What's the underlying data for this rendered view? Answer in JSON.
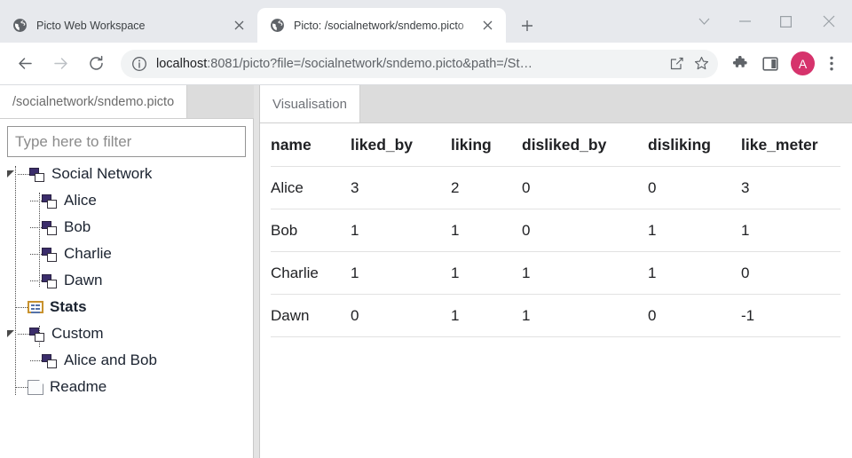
{
  "browser": {
    "tabs": [
      {
        "title": "Picto Web Workspace",
        "favicon": "globe-icon",
        "active": false,
        "close_label": "×"
      },
      {
        "title": "Picto: /socialnetwork/sndemo.picto",
        "favicon": "globe-icon",
        "active": true,
        "close_label": "×"
      }
    ],
    "new_tab_label": "+",
    "window_controls": {
      "tab_search": "tab-search-icon",
      "minimize": "minimize-icon",
      "maximize": "maximize-icon",
      "close": "close-icon"
    },
    "toolbar": {
      "back": "back-arrow-icon",
      "forward": "forward-arrow-icon",
      "reload": "reload-icon",
      "site_info": "info-circle-icon",
      "url_host": "localhost",
      "url_rest": ":8081/picto?file=/socialnetwork/sndemo.picto&path=/St…",
      "url_full": "localhost:8081/picto?file=/socialnetwork/sndemo.picto&path=/St…",
      "share": "share-icon",
      "bookmark": "star-icon",
      "extensions": "puzzle-piece-icon",
      "side_panel": "side-panel-icon",
      "profile_initial": "A",
      "profile_color": "#d6336c",
      "menu": "three-dot-menu-icon"
    }
  },
  "left_panel": {
    "tab_label": "/socialnetwork/sndemo.picto",
    "filter": {
      "value": "",
      "placeholder": "Type here to filter"
    },
    "tree": [
      {
        "label": "Social Network",
        "icon": "node-icon",
        "depth": 0,
        "expanded": true,
        "selected": false
      },
      {
        "label": "Alice",
        "icon": "node-icon",
        "depth": 1,
        "expanded": false,
        "selected": false
      },
      {
        "label": "Bob",
        "icon": "node-icon",
        "depth": 1,
        "expanded": false,
        "selected": false
      },
      {
        "label": "Charlie",
        "icon": "node-icon",
        "depth": 1,
        "expanded": false,
        "selected": false
      },
      {
        "label": "Dawn",
        "icon": "node-icon",
        "depth": 1,
        "expanded": false,
        "selected": false
      },
      {
        "label": "Stats",
        "icon": "table-icon",
        "depth": 0,
        "expanded": false,
        "selected": true
      },
      {
        "label": "Custom",
        "icon": "node-icon",
        "depth": 0,
        "expanded": true,
        "selected": false
      },
      {
        "label": "Alice and Bob",
        "icon": "node-icon",
        "depth": 1,
        "expanded": false,
        "selected": false
      },
      {
        "label": "Readme",
        "icon": "document-icon",
        "depth": 0,
        "expanded": false,
        "selected": false
      }
    ]
  },
  "right_panel": {
    "tab_label": "Visualisation",
    "table": {
      "columns": [
        "name",
        "liked_by",
        "liking",
        "disliked_by",
        "disliking",
        "like_meter"
      ],
      "rows": [
        {
          "name": "Alice",
          "liked_by": "3",
          "liking": "2",
          "disliked_by": "0",
          "disliking": "0",
          "like_meter": "3"
        },
        {
          "name": "Bob",
          "liked_by": "1",
          "liking": "1",
          "disliked_by": "0",
          "disliking": "1",
          "like_meter": "1"
        },
        {
          "name": "Charlie",
          "liked_by": "1",
          "liking": "1",
          "disliked_by": "1",
          "disliking": "1",
          "like_meter": "0"
        },
        {
          "name": "Dawn",
          "liked_by": "0",
          "liking": "1",
          "disliked_by": "1",
          "disliking": "0",
          "like_meter": "-1"
        }
      ]
    }
  }
}
